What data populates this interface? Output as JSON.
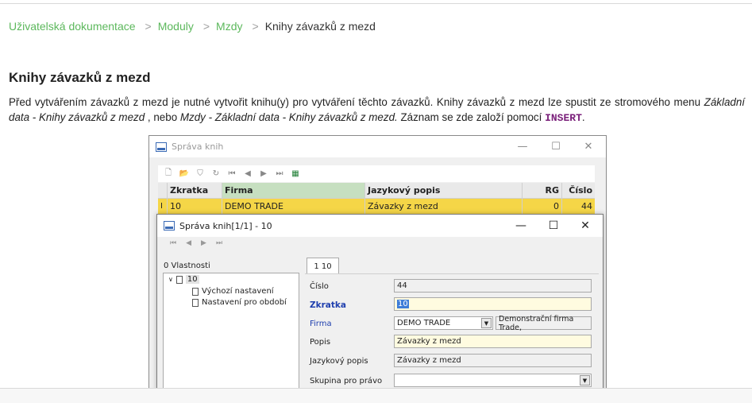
{
  "breadcrumb": {
    "items": [
      "Uživatelská dokumentace",
      "Moduly",
      "Mzdy"
    ],
    "current": "Knihy závazků z mezd"
  },
  "page": {
    "heading": "Knihy závazků z mezd",
    "para_1": "Před vytvářením závazků z mezd je nutné vytvořit knihu(y) pro vytváření těchto závazků. Knihy závazků z mezd lze spustit ze stromového menu",
    "para_path_1": "Základní data - Knihy závazků z mezd",
    "para_mid": " , nebo ",
    "para_path_2": "Mzdy - Základní data - Knihy závazků z mezd.",
    "para_end": " Záznam se zde založí pomocí ",
    "para_key": "INSERT",
    "para_tail": "."
  },
  "outer_window": {
    "title": "Správa knih",
    "columns": [
      "Zkratka",
      "Firma",
      "Jazykový popis",
      "RG",
      "Číslo"
    ],
    "row": {
      "marker": "I",
      "zkratka": "10",
      "firma": "DEMO TRADE",
      "popis": "Závazky z mezd",
      "rg": "0",
      "cislo": "44"
    }
  },
  "dialog": {
    "title": "Správa knih[1/1] - 10",
    "tree_label": "0 Vlastnosti",
    "tree": {
      "root": "10",
      "children": [
        "Výchozí nastavení",
        "Nastavení pro období"
      ]
    },
    "tab": "1 10",
    "fields": {
      "cislo_label": "Číslo",
      "cislo": "44",
      "zkratka_label": "Zkratka",
      "zkratka": "10",
      "firma_label": "Firma",
      "firma": "DEMO TRADE",
      "firma_desc": "Demonstrační firma Trade,",
      "popis_label": "Popis",
      "popis": "Závazky z mezd",
      "jazyk_label": "Jazykový popis",
      "jazyk": "Závazky z mezd",
      "skupina_label": "Skupina pro právo",
      "skupina": ""
    }
  },
  "colors": {
    "link": "#5cb85c",
    "key": "#7a1f7a",
    "row_selected": "#f5d647",
    "label_blue": "#1f3fae"
  }
}
